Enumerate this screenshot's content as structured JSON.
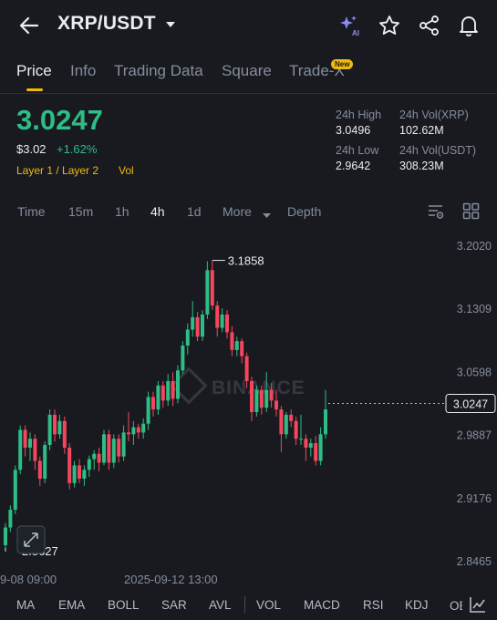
{
  "header": {
    "pair": "XRP/USDT"
  },
  "tabs": [
    {
      "label": "Price"
    },
    {
      "label": "Info"
    },
    {
      "label": "Trading Data"
    },
    {
      "label": "Square"
    },
    {
      "label": "Trade-X"
    }
  ],
  "new_badge": "New",
  "price": {
    "last": "3.0247",
    "usd": "$3.02",
    "change": "+1.62%",
    "tag1": "Layer 1 / Layer 2",
    "tag2": "Vol"
  },
  "stats": {
    "high_label": "24h High",
    "high": "3.0496",
    "vol_xrp_label": "24h Vol(XRP)",
    "vol_xrp": "102.62M",
    "low_label": "24h Low",
    "low": "2.9642",
    "vol_usdt_label": "24h Vol(USDT)",
    "vol_usdt": "308.23M"
  },
  "intervals": [
    "Time",
    "15m",
    "1h",
    "4h",
    "1d",
    "More",
    "Depth"
  ],
  "active_interval": "4h",
  "chart_data": {
    "type": "candlestick",
    "y_ticks": [
      "3.2020",
      "3.1309",
      "3.0598",
      "2.9887",
      "2.9176",
      "2.8465"
    ],
    "y_range": [
      2.8465,
      3.202
    ],
    "x_labels": [
      "9-08 09:00",
      "2025-09-12 13:00"
    ],
    "high_marker": "3.1858",
    "low_marker": "2.8627",
    "last_price_label": "3.0247",
    "watermark": "BINANCE",
    "candles": [
      [
        2.865,
        2.885,
        2.862,
        2.89
      ],
      [
        2.885,
        2.905,
        2.88,
        2.91
      ],
      [
        2.905,
        2.95,
        2.9,
        2.955
      ],
      [
        2.95,
        2.995,
        2.945,
        3.0
      ],
      [
        2.995,
        2.975,
        2.965,
        3.0
      ],
      [
        2.975,
        2.985,
        2.96,
        2.992
      ],
      [
        2.985,
        2.96,
        2.95,
        2.99
      ],
      [
        2.96,
        2.94,
        2.932,
        2.965
      ],
      [
        2.94,
        2.978,
        2.935,
        2.982
      ],
      [
        2.978,
        3.012,
        2.972,
        3.018
      ],
      [
        3.012,
        2.99,
        2.982,
        3.018
      ],
      [
        2.99,
        3.005,
        2.985,
        3.012
      ],
      [
        3.005,
        2.975,
        2.968,
        3.01
      ],
      [
        2.975,
        2.935,
        2.928,
        2.98
      ],
      [
        2.935,
        2.955,
        2.93,
        2.96
      ],
      [
        2.955,
        2.94,
        2.935,
        2.962
      ],
      [
        2.94,
        2.95,
        2.932,
        2.955
      ],
      [
        2.95,
        2.962,
        2.942,
        2.966
      ],
      [
        2.962,
        2.968,
        2.95,
        2.972
      ],
      [
        2.968,
        2.958,
        2.948,
        2.975
      ],
      [
        2.958,
        2.99,
        2.955,
        2.995
      ],
      [
        2.99,
        2.958,
        2.95,
        2.995
      ],
      [
        2.958,
        2.985,
        2.952,
        2.99
      ],
      [
        2.985,
        2.965,
        2.958,
        2.99
      ],
      [
        2.965,
        2.992,
        2.96,
        3.0
      ],
      [
        2.992,
        2.99,
        2.982,
        3.015
      ],
      [
        2.99,
        2.998,
        2.978,
        3.005
      ],
      [
        2.998,
        2.992,
        2.985,
        3.002
      ],
      [
        2.992,
        3.002,
        2.985,
        3.008
      ],
      [
        3.002,
        3.032,
        2.995,
        3.038
      ],
      [
        3.032,
        3.018,
        3.01,
        3.038
      ],
      [
        3.018,
        3.045,
        3.012,
        3.05
      ],
      [
        3.045,
        3.028,
        3.02,
        3.05
      ],
      [
        3.028,
        3.05,
        3.022,
        3.058
      ],
      [
        3.05,
        3.03,
        3.022,
        3.06
      ],
      [
        3.03,
        3.062,
        3.025,
        3.068
      ],
      [
        3.062,
        3.09,
        3.058,
        3.095
      ],
      [
        3.09,
        3.108,
        3.08,
        3.115
      ],
      [
        3.108,
        3.122,
        3.1,
        3.14
      ],
      [
        3.122,
        3.1,
        3.095,
        3.128
      ],
      [
        3.1,
        3.125,
        3.095,
        3.13
      ],
      [
        3.125,
        3.175,
        3.12,
        3.185
      ],
      [
        3.175,
        3.135,
        3.13,
        3.186
      ],
      [
        3.135,
        3.11,
        3.1,
        3.14
      ],
      [
        3.11,
        3.125,
        3.105,
        3.132
      ],
      [
        3.125,
        3.105,
        3.098,
        3.13
      ],
      [
        3.105,
        3.085,
        3.078,
        3.112
      ],
      [
        3.085,
        3.095,
        3.078,
        3.1
      ],
      [
        3.095,
        3.078,
        3.07,
        3.098
      ],
      [
        3.078,
        3.05,
        3.042,
        3.082
      ],
      [
        3.05,
        3.015,
        3.005,
        3.055
      ],
      [
        3.015,
        3.04,
        3.01,
        3.045
      ],
      [
        3.04,
        3.02,
        3.012,
        3.045
      ],
      [
        3.02,
        3.04,
        3.015,
        3.06
      ],
      [
        3.04,
        3.028,
        3.02,
        3.048
      ],
      [
        3.028,
        3.018,
        3.01,
        3.04
      ],
      [
        3.018,
        2.99,
        2.97,
        3.022
      ],
      [
        2.99,
        3.012,
        2.985,
        3.015
      ],
      [
        3.012,
        3.005,
        2.998,
        3.018
      ],
      [
        3.005,
        2.985,
        2.978,
        3.01
      ],
      [
        2.985,
        2.985,
        2.978,
        3.012
      ],
      [
        2.985,
        2.975,
        2.96,
        2.99
      ],
      [
        2.975,
        2.98,
        2.965,
        2.985
      ],
      [
        2.98,
        2.96,
        2.955,
        2.988
      ],
      [
        2.96,
        2.99,
        2.955,
        2.998
      ],
      [
        2.99,
        3.018,
        2.985,
        3.04
      ]
    ]
  },
  "indicators": [
    "MA",
    "EMA",
    "BOLL",
    "SAR",
    "AVL",
    "VOL",
    "MACD",
    "RSI",
    "KDJ",
    "OBV"
  ],
  "colors": {
    "up": "#2ebd85",
    "down": "#f6465d",
    "accent": "#f0b90b",
    "bg": "#181a20"
  }
}
